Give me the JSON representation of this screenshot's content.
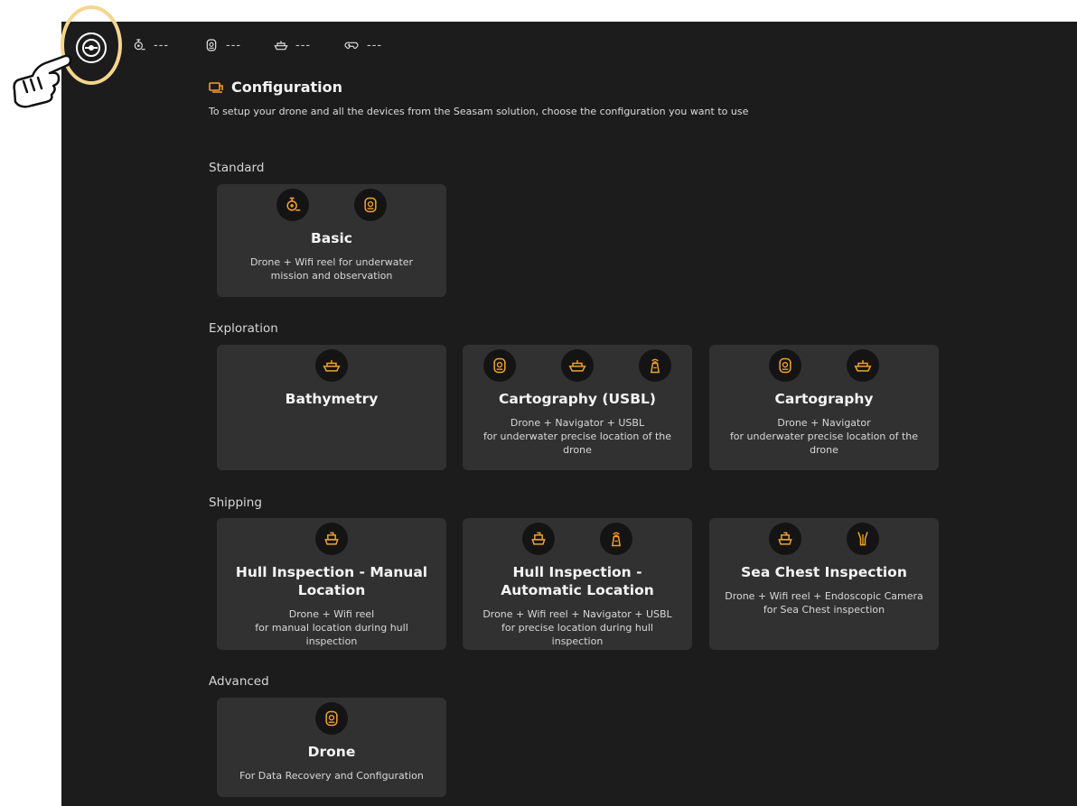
{
  "topbar": {
    "statuses": [
      {
        "icon": "reel-icon",
        "value": "---"
      },
      {
        "icon": "drone-icon",
        "value": "---"
      },
      {
        "icon": "boat-icon",
        "value": "---"
      },
      {
        "icon": "gamepad-icon",
        "value": "---"
      }
    ]
  },
  "header": {
    "icon": "configuration-icon",
    "title": "Configuration",
    "description": "To setup your drone and all the devices from the Seasam solution, choose the configuration you want to use"
  },
  "groups": {
    "standard": "Standard",
    "exploration": "Exploration",
    "shipping": "Shipping",
    "advanced": "Advanced"
  },
  "cards": {
    "basic": {
      "title": "Basic",
      "desc": "Drone + Wifi reel for underwater\nmission and observation",
      "icons": [
        "reel-icon",
        "drone-icon"
      ]
    },
    "bathymetry": {
      "title": "Bathymetry",
      "desc": "",
      "icons": [
        "boat-icon"
      ]
    },
    "cartography_usbl": {
      "title": "Cartography (USBL)",
      "desc": "Drone + Navigator + USBL\nfor underwater precise location of the\ndrone",
      "icons": [
        "drone-icon",
        "boat-icon",
        "usbl-icon"
      ]
    },
    "cartography": {
      "title": "Cartography",
      "desc": "Drone + Navigator\nfor underwater precise location of the\ndrone",
      "icons": [
        "drone-icon",
        "boat-icon"
      ]
    },
    "hull_manual": {
      "title": "Hull Inspection - Manual Location",
      "desc": "Drone + Wifi reel\nfor manual location during hull inspection",
      "icons": [
        "ship-icon"
      ]
    },
    "hull_auto": {
      "title": "Hull Inspection - Automatic Location",
      "desc": "Drone + Wifi reel + Navigator + USBL\nfor precise location during hull inspection",
      "icons": [
        "ship-icon",
        "usbl-icon"
      ]
    },
    "sea_chest": {
      "title": "Sea Chest Inspection",
      "desc": "Drone + Wifi reel + Endoscopic Camera\nfor Sea Chest inspection",
      "icons": [
        "ship-icon",
        "endoscope-icon"
      ]
    },
    "drone": {
      "title": "Drone",
      "desc": "For Data Recovery and Configuration",
      "icons": [
        "drone-icon"
      ]
    }
  },
  "colors": {
    "accent": "#f0a12c",
    "background": "#1c1c1c",
    "card": "#313131",
    "highlight": "#f6d58e"
  }
}
